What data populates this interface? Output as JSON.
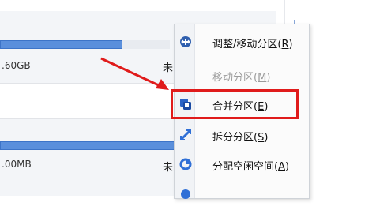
{
  "partitions": [
    {
      "size": ".60GB",
      "state": "未",
      "fill": 0.72
    },
    {
      "size": ".00MB",
      "state": "未",
      "fill": 1.0
    }
  ],
  "context_menu": {
    "items": [
      {
        "label": "调整/移动分区",
        "accel": "R",
        "icon": "resize-move-icon",
        "disabled": false
      },
      {
        "label": "移动分区",
        "accel": "M",
        "icon": "move-icon",
        "disabled": true
      },
      {
        "label": "合并分区",
        "accel": "E",
        "icon": "merge-icon",
        "disabled": false,
        "highlighted": true
      },
      {
        "label": "拆分分区",
        "accel": "S",
        "icon": "split-icon",
        "disabled": false
      },
      {
        "label": "分配空闲空间",
        "accel": "A",
        "icon": "allocate-space-icon",
        "disabled": false
      }
    ]
  },
  "colors": {
    "bar": "#5a8fdc",
    "highlight": "#e01b1b",
    "arrow": "#e01b1b",
    "disabled_text": "#9b9b9b"
  }
}
